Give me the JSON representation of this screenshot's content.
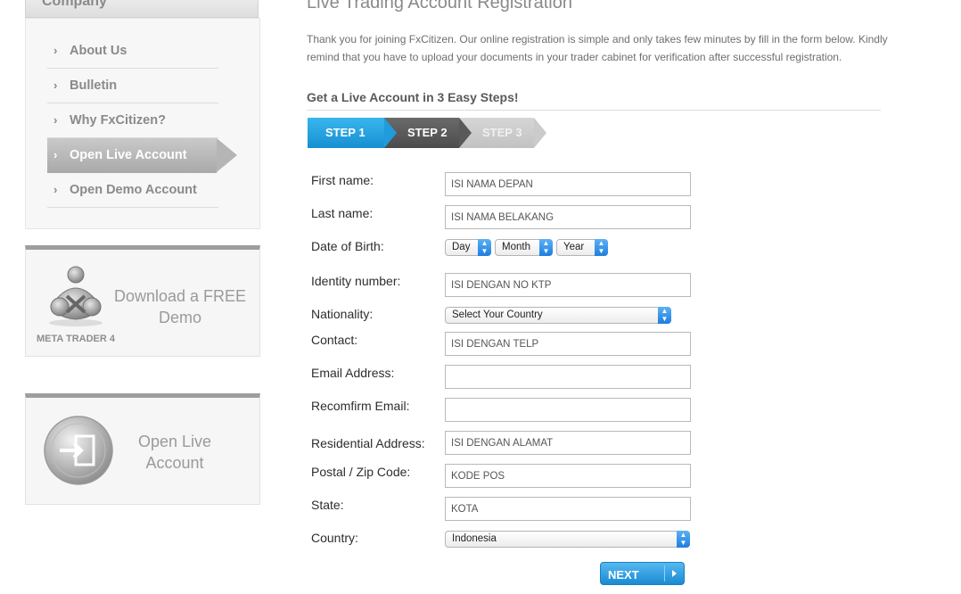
{
  "sidebar": {
    "heading": "Company",
    "items": [
      {
        "label": "About Us"
      },
      {
        "label": "Bulletin"
      },
      {
        "label": "Why FxCitizen?"
      },
      {
        "label": "Open Live Account",
        "active": true
      },
      {
        "label": "Open Demo Account"
      }
    ],
    "chevron": "›",
    "demo_promo": {
      "title": "Download a FREE Demo",
      "logo_label": "META TRADER 4"
    },
    "live_promo": {
      "title": "Open Live Account"
    }
  },
  "main": {
    "title": "Live Trading Account Registration",
    "intro": "Thank you for joining FxCitizen. Our online registration is simple and only takes few minutes by fill in the form below. Kindly remind that you have to upload your documents in your trader cabinet for verification after successful registration.",
    "steps_heading": "Get a Live Account in 3 Easy Steps!",
    "steps": [
      "STEP 1",
      "STEP 2",
      "STEP 3"
    ],
    "form": {
      "first_name": {
        "label": "First name:",
        "placeholder": "ISI NAMA DEPAN"
      },
      "last_name": {
        "label": "Last name:",
        "placeholder": "ISI NAMA BELAKANG"
      },
      "dob": {
        "label": "Date of Birth:",
        "day": "Day",
        "month": "Month",
        "year": "Year"
      },
      "identity": {
        "label": "Identity number:",
        "placeholder": "ISI DENGAN NO KTP"
      },
      "nationality": {
        "label": "Nationality:",
        "selected": "Select Your Country"
      },
      "contact": {
        "label": "Contact:",
        "placeholder": "ISI DENGAN TELP"
      },
      "email": {
        "label": "Email Address:",
        "placeholder": ""
      },
      "email_confirm": {
        "label": "Recomfirm Email:",
        "placeholder": ""
      },
      "address": {
        "label": "Residential Address:",
        "placeholder": "ISI DENGAN ALAMAT"
      },
      "postal": {
        "label": "Postal / Zip Code:",
        "placeholder": "KODE POS"
      },
      "state": {
        "label": "State:",
        "placeholder": "KOTA"
      },
      "country": {
        "label": "Country:",
        "selected": "Indonesia"
      }
    },
    "next_label": "NEXT"
  },
  "colors": {
    "accent": "#1a8ad2",
    "step_active": "#209cdc",
    "step_dark": "#595959",
    "step_light": "#cbcbcb"
  }
}
